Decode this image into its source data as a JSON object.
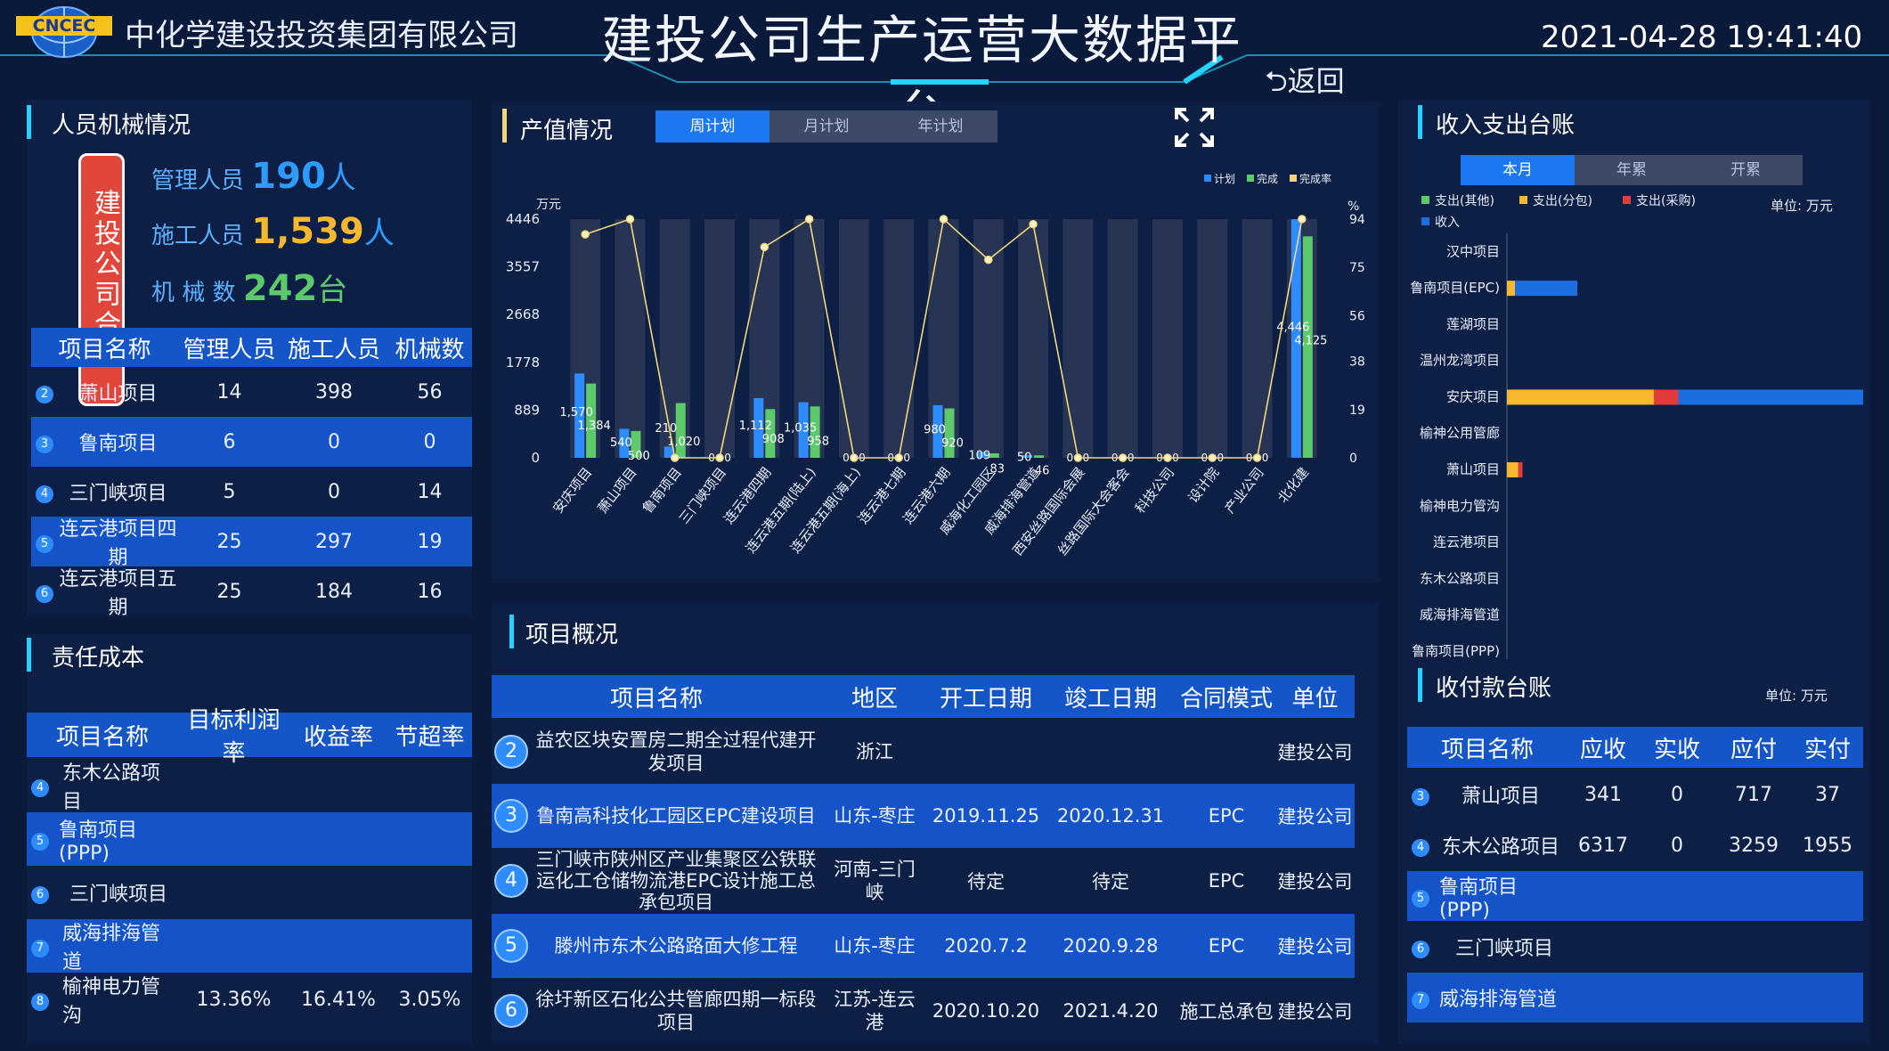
{
  "header": {
    "logo_text": "CNCEC",
    "company": "中化学建设投资集团有限公司",
    "title": "建投公司生产运营大数据平台",
    "datetime": "2021-04-28 19:41:40",
    "back": "返回"
  },
  "personnel": {
    "title": "人员机械情况",
    "total_badge": "建投公司合计",
    "managers_label": "管理人员",
    "managers_value": "190",
    "managers_unit": "人",
    "workers_label": "施工人员",
    "workers_value": "1,539",
    "workers_unit": "人",
    "machines_label": "机 械 数",
    "machines_value": "242",
    "machines_unit": "台",
    "columns": [
      "项目名称",
      "管理人员",
      "施工人员",
      "机械数"
    ],
    "rows": [
      {
        "no": "2",
        "name": "萧山项目",
        "managers": "14",
        "workers": "398",
        "machines": "56"
      },
      {
        "no": "3",
        "name": "鲁南项目",
        "managers": "6",
        "workers": "0",
        "machines": "0"
      },
      {
        "no": "4",
        "name": "三门峡项目",
        "managers": "5",
        "workers": "0",
        "machines": "14"
      },
      {
        "no": "5",
        "name": "连云港项目四期",
        "managers": "25",
        "workers": "297",
        "machines": "19"
      },
      {
        "no": "6",
        "name": "连云港项目五期",
        "managers": "25",
        "workers": "184",
        "machines": "16"
      }
    ]
  },
  "cost": {
    "title": "责任成本",
    "columns": [
      "项目名称",
      "目标利润率",
      "收益率",
      "节超率"
    ],
    "rows": [
      {
        "no": "4",
        "name": "东木公路项目",
        "target": "",
        "yield": "",
        "saving": ""
      },
      {
        "no": "5",
        "name": "鲁南项目(PPP)",
        "target": "",
        "yield": "",
        "saving": ""
      },
      {
        "no": "6",
        "name": "三门峡项目",
        "target": "",
        "yield": "",
        "saving": ""
      },
      {
        "no": "7",
        "name": "威海排海管道",
        "target": "",
        "yield": "",
        "saving": ""
      },
      {
        "no": "8",
        "name": "榆神电力管沟",
        "target": "13.36%",
        "yield": "16.41%",
        "saving": "3.05%"
      }
    ]
  },
  "output": {
    "title": "产值情况",
    "tabs": [
      "周计划",
      "月计划",
      "年计划"
    ],
    "active_tab": 0,
    "expand_icon": "expand-icon"
  },
  "income": {
    "title": "收入支出台账",
    "tabs": [
      "本月",
      "年累",
      "开累"
    ],
    "active_tab": 0,
    "unit": "单位: 万元"
  },
  "projects": {
    "title": "项目概况",
    "columns": [
      "项目名称",
      "地区",
      "开工日期",
      "竣工日期",
      "合同模式",
      "单位"
    ],
    "rows": [
      {
        "no": "2",
        "name": "益农区块安置房二期全过程代建开发项目",
        "region": "浙江",
        "start": "",
        "end": "",
        "mode": "",
        "unit": "建投公司"
      },
      {
        "no": "3",
        "name": "鲁南高科技化工园区EPC建设项目",
        "region": "山东-枣庄",
        "start": "2019.11.25",
        "end": "2020.12.31",
        "mode": "EPC",
        "unit": "建投公司"
      },
      {
        "no": "4",
        "name": "三门峡市陕州区产业集聚区公铁联运化工仓储物流港EPC设计施工总承包项目",
        "region": "河南-三门峡",
        "start": "待定",
        "end": "待定",
        "mode": "EPC",
        "unit": "建投公司"
      },
      {
        "no": "5",
        "name": "滕州市东木公路路面大修工程",
        "region": "山东-枣庄",
        "start": "2020.7.2",
        "end": "2020.9.28",
        "mode": "EPC",
        "unit": "建投公司"
      },
      {
        "no": "6",
        "name": "徐圩新区石化公共管廊四期一标段项目",
        "region": "江苏-连云港",
        "start": "2020.10.20",
        "end": "2021.4.20",
        "mode": "施工总承包",
        "unit": "建投公司"
      }
    ]
  },
  "receivable": {
    "title": "收付款台账",
    "unit": "单位: 万元",
    "columns": [
      "项目名称",
      "应收",
      "实收",
      "应付",
      "实付"
    ],
    "rows": [
      {
        "no": "3",
        "name": "萧山项目",
        "recv": "341",
        "got": "0",
        "pay": "717",
        "paid": "37"
      },
      {
        "no": "4",
        "name": "东木公路项目",
        "recv": "6317",
        "got": "0",
        "pay": "3259",
        "paid": "1955"
      },
      {
        "no": "5",
        "name": "鲁南项目(PPP)",
        "recv": "",
        "got": "",
        "pay": "",
        "paid": ""
      },
      {
        "no": "6",
        "name": "三门峡项目",
        "recv": "",
        "got": "",
        "pay": "",
        "paid": ""
      },
      {
        "no": "7",
        "name": "威海排海管道",
        "recv": "",
        "got": "",
        "pay": "",
        "paid": ""
      }
    ]
  },
  "colors": {
    "plan": "#2e8cff",
    "done": "#5cc96a",
    "rate": "#f1d77a",
    "red": "#e23b3b",
    "yellow": "#f5b82e",
    "blue": "#1c6fe0",
    "accent": "#24d3ff"
  },
  "chart_data": [
    {
      "type": "bar",
      "title": "",
      "ylabel": "万元",
      "y2label": "%",
      "ylim": [
        0,
        4446
      ],
      "yticks": [
        "0",
        "889",
        "1778",
        "2668",
        "3557",
        "4446"
      ],
      "y2lim": [
        0,
        94
      ],
      "y2ticks": [
        "0",
        "19",
        "38",
        "56",
        "75",
        "94"
      ],
      "legend": [
        "计划",
        "完成",
        "完成率"
      ],
      "legend_position": "top-right",
      "categories": [
        "安庆项目",
        "萧山项目",
        "鲁南项目",
        "三门峡项目",
        "连云港四期",
        "连云港五期(陆上)",
        "连云港五期(海上)",
        "连云港七期",
        "连云港六期",
        "威海化工园区",
        "威海排海管道",
        "西安丝路国际会展",
        "丝路国际大会客会",
        "科技公司",
        "设计院",
        "产业公司",
        "北化建"
      ],
      "series": [
        {
          "name": "计划",
          "values": [
            1570,
            540,
            210,
            0,
            1112,
            1035,
            0,
            0,
            980,
            109,
            50,
            0,
            0,
            0,
            0,
            0,
            4446
          ],
          "labels": [
            "1,570",
            "540",
            "210",
            "0",
            "1,112",
            "1,035",
            "0",
            "0",
            "980",
            "109",
            "50",
            "0",
            "0",
            "0",
            "0",
            "0",
            "4,446"
          ]
        },
        {
          "name": "完成",
          "values": [
            1384,
            500,
            1020,
            0,
            908,
            958,
            0,
            0,
            920,
            83,
            46,
            0,
            0,
            0,
            0,
            0,
            4125
          ],
          "labels": [
            "1,384",
            "500",
            "1,020",
            "0",
            "908",
            "958",
            "0",
            "0",
            "920",
            "83",
            "46",
            "0",
            "0",
            "0",
            "0",
            "0",
            "4,125"
          ]
        },
        {
          "name": "完成率",
          "values": [
            88,
            94,
            0,
            0,
            83,
            94,
            0,
            0,
            94,
            78,
            92,
            0,
            0,
            0,
            0,
            0,
            94
          ]
        }
      ]
    },
    {
      "type": "bar",
      "orientation": "horizontal",
      "stacked": true,
      "legend": [
        "支出(其他)",
        "支出(分包)",
        "支出(采购)",
        "收入"
      ],
      "xlim": [
        0,
        8000
      ],
      "xticks": [
        "0",
        "2000",
        "4000",
        "6000",
        "8000"
      ],
      "categories": [
        "汉中项目",
        "鲁南项目(EPC)",
        "莲湖项目",
        "温州龙湾项目",
        "安庆项目",
        "榆神公用管廊",
        "萧山项目",
        "榆神电力管沟",
        "连云港项目",
        "东木公路项目",
        "威海排海管道",
        "鲁南项目(PPP)",
        "三门峡项目"
      ],
      "series": [
        {
          "name": "支出(其他)",
          "values": [
            0,
            0,
            0,
            0,
            0,
            0,
            0,
            0,
            0,
            0,
            0,
            0,
            0
          ]
        },
        {
          "name": "支出(分包)",
          "values": [
            0,
            180,
            0,
            0,
            3300,
            0,
            250,
            0,
            0,
            0,
            0,
            0,
            0
          ]
        },
        {
          "name": "支出(采购)",
          "values": [
            0,
            0,
            0,
            0,
            550,
            0,
            100,
            0,
            0,
            0,
            0,
            0,
            0
          ]
        },
        {
          "name": "收入",
          "values": [
            0,
            1400,
            0,
            0,
            4150,
            0,
            0,
            0,
            0,
            0,
            0,
            0,
            0
          ]
        }
      ]
    }
  ]
}
